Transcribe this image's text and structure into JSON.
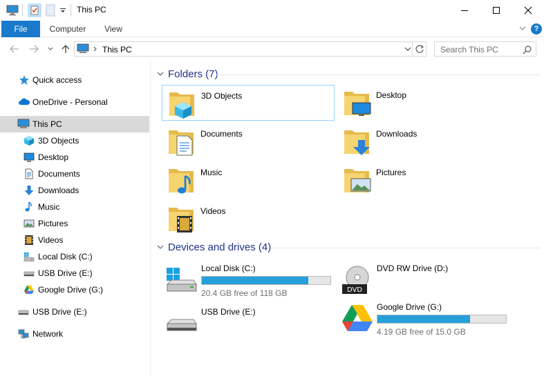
{
  "window": {
    "title": "This PC"
  },
  "ribbon": {
    "file": "File",
    "computer": "Computer",
    "view": "View",
    "help": "?"
  },
  "address": {
    "path": "This PC",
    "search_placeholder": "Search This PC"
  },
  "sidebar": {
    "items": [
      {
        "label": "Quick access",
        "icon": "star-icon"
      },
      {
        "label": "OneDrive - Personal",
        "icon": "cloud-icon"
      },
      {
        "label": "This PC",
        "icon": "computer-icon",
        "selected": true
      },
      {
        "label": "3D Objects",
        "icon": "cube-icon"
      },
      {
        "label": "Desktop",
        "icon": "desktop-icon"
      },
      {
        "label": "Documents",
        "icon": "document-icon"
      },
      {
        "label": "Downloads",
        "icon": "download-arrow-icon"
      },
      {
        "label": "Music",
        "icon": "music-note-icon"
      },
      {
        "label": "Pictures",
        "icon": "picture-icon"
      },
      {
        "label": "Videos",
        "icon": "film-icon"
      },
      {
        "label": "Local Disk (C:)",
        "icon": "windows-disk-icon"
      },
      {
        "label": "USB Drive (E:)",
        "icon": "usb-drive-icon"
      },
      {
        "label": "Google Drive (G:)",
        "icon": "google-drive-icon"
      },
      {
        "label": "USB Drive (E:)",
        "icon": "usb-drive-icon"
      },
      {
        "label": "Network",
        "icon": "network-icon"
      }
    ]
  },
  "folders": {
    "header": "Folders (7)",
    "items": [
      {
        "name": "3D Objects",
        "icon": "folder-3d-objects-icon",
        "selected": true
      },
      {
        "name": "Desktop",
        "icon": "folder-desktop-icon"
      },
      {
        "name": "Documents",
        "icon": "folder-documents-icon"
      },
      {
        "name": "Downloads",
        "icon": "folder-downloads-icon"
      },
      {
        "name": "Music",
        "icon": "folder-music-icon"
      },
      {
        "name": "Pictures",
        "icon": "folder-pictures-icon"
      },
      {
        "name": "Videos",
        "icon": "folder-videos-icon"
      }
    ]
  },
  "drives": {
    "header": "Devices and drives (4)",
    "items": [
      {
        "name": "Local Disk (C:)",
        "free": "20.4 GB free of 118 GB",
        "used_fraction": 0.83,
        "icon": "windows-disk-icon"
      },
      {
        "name": "DVD RW Drive (D:)",
        "icon": "dvd-drive-icon"
      },
      {
        "name": "USB Drive (E:)",
        "icon": "usb-drive-icon"
      },
      {
        "name": "Google Drive (G:)",
        "free": "4.19 GB free of 15.0 GB",
        "used_fraction": 0.72,
        "icon": "google-drive-icon"
      }
    ]
  },
  "colors": {
    "accent": "#1979ca",
    "bar_fill": "#26a0da",
    "selection": "#d9d9d9",
    "group_header": "#1e3287"
  }
}
